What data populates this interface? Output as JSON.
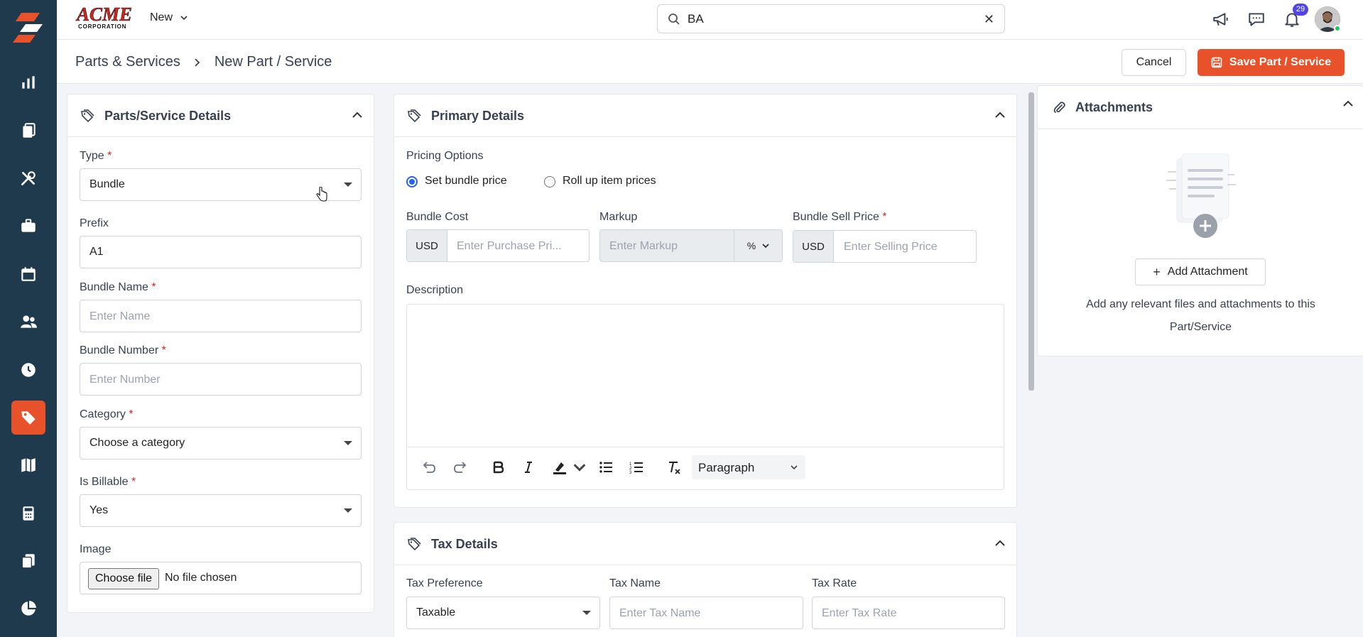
{
  "brand": {
    "name": "ACME",
    "tagline": "CORPORATION"
  },
  "topbar": {
    "new_label": "New",
    "search_value": "BA",
    "notifications_count": "29"
  },
  "header": {
    "breadcrumb_parent": "Parts & Services",
    "breadcrumb_current": "New Part / Service",
    "cancel_label": "Cancel",
    "save_label": "Save Part / Service"
  },
  "sidebar": {
    "items": [
      "dashboard",
      "jobs",
      "services",
      "briefcase",
      "calendar",
      "customers",
      "timesheets",
      "parts-services",
      "maps",
      "calculator",
      "documents",
      "reports"
    ],
    "active": "parts-services"
  },
  "details": {
    "title": "Parts/Service Details",
    "type_label": "Type",
    "type_value": "Bundle",
    "prefix_label": "Prefix",
    "prefix_value": "A1",
    "bundle_name_label": "Bundle Name",
    "bundle_name_placeholder": "Enter Name",
    "bundle_number_label": "Bundle Number",
    "bundle_number_placeholder": "Enter Number",
    "category_label": "Category",
    "category_value": "Choose a category",
    "billable_label": "Is Billable",
    "billable_value": "Yes",
    "image_label": "Image",
    "choose_file_label": "Choose file",
    "no_file_label": "No file chosen"
  },
  "primary": {
    "title": "Primary Details",
    "pricing_label": "Pricing Options",
    "option_bundle": "Set bundle price",
    "option_rollup": "Roll up item prices",
    "bundle_cost_label": "Bundle Cost",
    "currency": "USD",
    "cost_placeholder": "Enter Purchase Pri...",
    "markup_label": "Markup",
    "markup_placeholder": "Enter Markup",
    "sell_label": "Bundle Sell Price",
    "sell_placeholder": "Enter Selling Price",
    "description_label": "Description",
    "paragraph_label": "Paragraph"
  },
  "tax": {
    "title": "Tax Details",
    "preference_label": "Tax Preference",
    "preference_value": "Taxable",
    "name_label": "Tax Name",
    "name_placeholder": "Enter Tax Name",
    "rate_label": "Tax Rate",
    "rate_placeholder": "Enter Tax Rate"
  },
  "attachments": {
    "title": "Attachments",
    "add_label": "Add Attachment",
    "help_line1": "Add any relevant files and attachments to this",
    "help_line2": "Part/Service"
  },
  "colors": {
    "accent": "#e8522b",
    "sidebar": "#1f3a4d",
    "radio": "#2563eb",
    "badge": "#4f46e5"
  }
}
